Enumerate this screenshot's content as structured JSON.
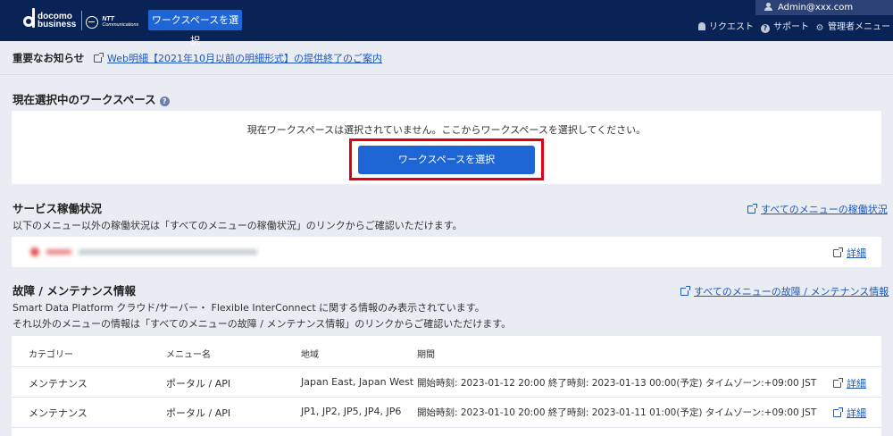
{
  "header": {
    "brand_line1": "docomo",
    "brand_line2": "business",
    "partner_name": "NTT",
    "partner_sub": "Communications",
    "workspace_button": "ワークスペースを選択",
    "user": "Admin@xxx.com",
    "menu": [
      {
        "label": "リクエスト",
        "icon": "bell-icon"
      },
      {
        "label": "サポート",
        "icon": "help-icon"
      },
      {
        "label": "管理者メニュー",
        "icon": "gear-icon"
      }
    ]
  },
  "notice": {
    "title": "重要なお知らせ",
    "link": "Web明細【2021年10月以前の明細形式】の提供終了のご案内"
  },
  "current_workspace": {
    "title": "現在選択中のワークスペース",
    "message": "現在ワークスペースは選択されていません。ここからワークスペースを選択してください。",
    "button": "ワークスペースを選択"
  },
  "service_status": {
    "title": "サービス稼働状況",
    "description": "以下のメニュー以外の稼働状況は「すべてのメニューの稼働状況」のリンクからご確認いただけます。",
    "all_link": "すべてのメニューの稼働状況",
    "detail_link": "詳細"
  },
  "maintenance": {
    "title": "故障 / メンテナンス情報",
    "description1": "Smart Data Platform クラウド/サーバー・ Flexible InterConnect に関する情報のみ表示されています。",
    "description2": "それ以外のメニューの情報は「すべてのメニューの故障 / メンテナンス情報」のリンクからご確認いただけます。",
    "all_link": "すべてのメニューの故障 / メンテナンス情報",
    "columns": [
      "カテゴリー",
      "メニュー名",
      "地域",
      "期間"
    ],
    "rows": [
      {
        "category": "メンテナンス",
        "menu": "ポータル / API",
        "region": "Japan East, Japan West",
        "period": "開始時刻: 2023-01-12 20:00 終了時刻: 2023-01-13 00:00(予定) タイムゾーン:+09:00 JST",
        "detail": "詳細"
      },
      {
        "category": "メンテナンス",
        "menu": "ポータル / API",
        "region": "JP1, JP2, JP5, JP4, JP6",
        "period": "開始時刻: 2023-01-10 20:00 終了時刻: 2023-01-11 01:00(予定) タイムゾーン:+09:00 JST",
        "detail": "詳細"
      }
    ]
  },
  "colors": {
    "header_bg": "#0a2357",
    "primary_button": "#1e66d6",
    "link": "#1f57b8",
    "highlight_frame": "#e00012",
    "page_bg": "#e9edf3"
  }
}
